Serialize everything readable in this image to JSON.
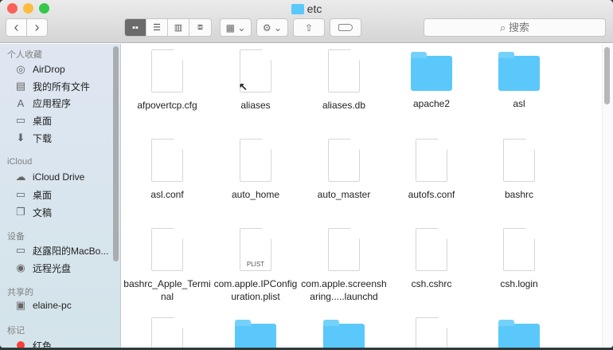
{
  "window": {
    "title": "etc"
  },
  "toolbar": {
    "back": "‹",
    "forward": "›",
    "search_placeholder": "搜索",
    "view_modes": [
      "icon",
      "list",
      "column",
      "cover-flow"
    ],
    "active_view": "icon"
  },
  "sidebar": {
    "sections": [
      {
        "title": "个人收藏",
        "items": [
          {
            "label": "AirDrop",
            "icon": "airdrop-icon"
          },
          {
            "label": "我的所有文件",
            "icon": "all-files-icon"
          },
          {
            "label": "应用程序",
            "icon": "applications-icon"
          },
          {
            "label": "桌面",
            "icon": "desktop-icon"
          },
          {
            "label": "下载",
            "icon": "download-icon"
          }
        ]
      },
      {
        "title": "iCloud",
        "items": [
          {
            "label": "iCloud Drive",
            "icon": "cloud-icon"
          },
          {
            "label": "桌面",
            "icon": "desktop-icon"
          },
          {
            "label": "文稿",
            "icon": "documents-icon"
          }
        ]
      },
      {
        "title": "设备",
        "items": [
          {
            "label": "赵露阳的MacBo...",
            "icon": "laptop-icon"
          },
          {
            "label": "远程光盘",
            "icon": "disc-icon"
          }
        ]
      },
      {
        "title": "共享的",
        "items": [
          {
            "label": "elaine-pc",
            "icon": "monitor-icon"
          }
        ]
      },
      {
        "title": "标记",
        "items": [
          {
            "label": "红色",
            "icon": "red-tag-icon"
          }
        ]
      }
    ]
  },
  "files": [
    {
      "name": "afpovertcp.cfg",
      "type": "doc"
    },
    {
      "name": "aliases",
      "type": "alias"
    },
    {
      "name": "aliases.db",
      "type": "doc"
    },
    {
      "name": "apache2",
      "type": "folder"
    },
    {
      "name": "asl",
      "type": "folder"
    },
    {
      "name": "asl.conf",
      "type": "doc"
    },
    {
      "name": "auto_home",
      "type": "doc"
    },
    {
      "name": "auto_master",
      "type": "doc"
    },
    {
      "name": "autofs.conf",
      "type": "doc"
    },
    {
      "name": "bashrc",
      "type": "doc"
    },
    {
      "name": "bashrc_Apple_Terminal",
      "type": "doc"
    },
    {
      "name": "com.apple.IPConfiguration.plist",
      "type": "plist",
      "badge": "PLIST"
    },
    {
      "name": "com.apple.screensharing.....launchd",
      "type": "doc"
    },
    {
      "name": "csh.cshrc",
      "type": "doc"
    },
    {
      "name": "csh.login",
      "type": "doc"
    },
    {
      "name": "",
      "type": "doc"
    },
    {
      "name": "",
      "type": "folder"
    },
    {
      "name": "",
      "type": "folder"
    },
    {
      "name": "",
      "type": "doc"
    },
    {
      "name": "",
      "type": "folder"
    }
  ],
  "colors": {
    "folder": "#5ac8fa",
    "close": "#fc605c",
    "minimize": "#fdbc40",
    "zoom": "#34c84a",
    "red_tag": "#fc3d39"
  }
}
